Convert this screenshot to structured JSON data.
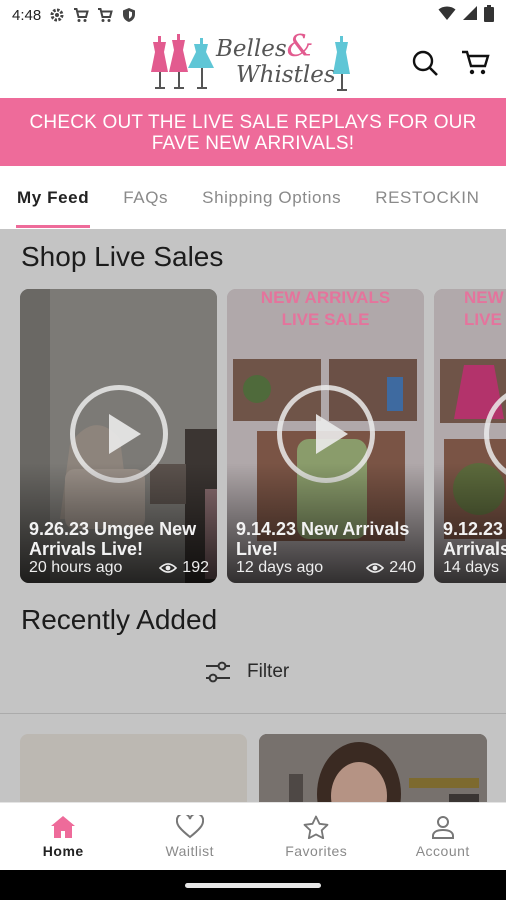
{
  "status_bar": {
    "time": "4:48",
    "left_icons": [
      "gear-icon",
      "cart-icon",
      "cart-icon",
      "shield-icon"
    ],
    "right_icons": [
      "wifi-icon",
      "signal-icon",
      "battery-icon"
    ]
  },
  "header": {
    "logo_line1": "Belles",
    "logo_amp": "&",
    "logo_line2": "Whistles",
    "icons": [
      "search-icon",
      "cart-icon"
    ]
  },
  "banner": {
    "line1": "CHECK OUT THE LIVE SALE REPLAYS FOR OUR",
    "line2": "FAVE NEW ARRIVALS!"
  },
  "tabs": [
    {
      "label": "My Feed",
      "active": true
    },
    {
      "label": "FAQs",
      "active": false
    },
    {
      "label": "Shipping Options",
      "active": false
    },
    {
      "label": "RESTOCKIN",
      "active": false
    }
  ],
  "live_sales": {
    "title": "Shop Live Sales",
    "cards": [
      {
        "title": "9.26.23 Umgee New Arrivals Live!",
        "time": "20 hours ago",
        "views": "192"
      },
      {
        "title": "9.14.23 New Arrivals Live!",
        "time": "12 days ago",
        "views": "240",
        "poster_text": [
          "NEW ARRIVALS",
          "LIVE SALE"
        ]
      },
      {
        "title": "9.12.23 Arrivals",
        "time": "14 days",
        "views": "",
        "poster_text": [
          "NEW",
          "LIVE"
        ]
      }
    ]
  },
  "recently_added": {
    "title": "Recently Added",
    "filter_label": "Filter"
  },
  "bottom_nav": [
    {
      "label": "Home",
      "icon": "home-icon",
      "active": true
    },
    {
      "label": "Waitlist",
      "icon": "heart-icon",
      "active": false
    },
    {
      "label": "Favorites",
      "icon": "star-icon",
      "active": false
    },
    {
      "label": "Account",
      "icon": "account-icon",
      "active": false
    }
  ],
  "colors": {
    "brand_pink": "#ee6b9a",
    "overlay_gray": "#c4c4c4",
    "text_dark": "#222222"
  }
}
